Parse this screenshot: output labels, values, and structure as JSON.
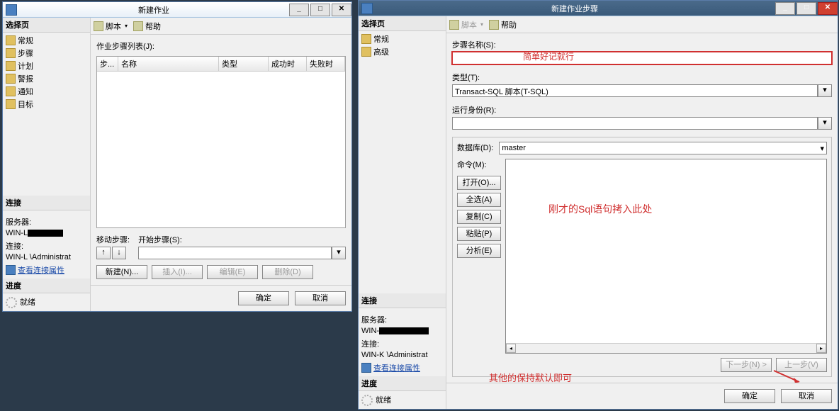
{
  "win1": {
    "title": "新建作业",
    "select_page": "选择页",
    "pages": [
      "常规",
      "步骤",
      "计划",
      "警报",
      "通知",
      "目标"
    ],
    "toolbar": {
      "script": "脚本",
      "help": "帮助"
    },
    "step_list_label": "作业步骤列表(J):",
    "cols": {
      "step": "步...",
      "name": "名称",
      "type": "类型",
      "on_success": "成功时",
      "on_fail": "失败时"
    },
    "move_label": "移动步骤:",
    "start_label": "开始步骤(S):",
    "buttons": {
      "new": "新建(N)...",
      "insert": "插入(I)...",
      "edit": "编辑(E)",
      "delete": "删除(D)"
    },
    "conn_header": "连接",
    "server_label": "服务器:",
    "server_val": "WIN-L",
    "conn_label": "连接:",
    "conn_val": "WIN-L          \\Administrat",
    "view_conn": "查看连接属性",
    "progress_header": "进度",
    "progress_status": "就绪",
    "footer": {
      "ok": "确定",
      "cancel": "取消"
    }
  },
  "win2": {
    "title": "新建作业步骤",
    "select_page": "选择页",
    "pages": [
      "常规",
      "高级"
    ],
    "toolbar": {
      "script": "脚本",
      "help": "帮助"
    },
    "step_name_label": "步骤名称(S):",
    "step_name_val": "",
    "anno_name": "简单好记就行",
    "type_label": "类型(T):",
    "type_val": "Transact-SQL 脚本(T-SQL)",
    "runas_label": "运行身份(R):",
    "runas_val": "",
    "db_label": "数据库(D):",
    "db_val": "master",
    "cmd_label": "命令(M):",
    "cmd_buttons": {
      "open": "打开(O)...",
      "selectall": "全选(A)",
      "copy": "复制(C)",
      "paste": "粘贴(P)",
      "parse": "分析(E)"
    },
    "anno_cmd": "刚才的Sql语句拷入此处",
    "nav": {
      "next": "下一步(N) >",
      "prev": "上一步(V)"
    },
    "anno_bottom": "其他的保持默认即可",
    "conn_header": "连接",
    "server_label": "服务器:",
    "server_val": "WIN-",
    "conn_label": "连接:",
    "conn_val": "WIN-K         \\Administrat",
    "view_conn": "查看连接属性",
    "progress_header": "进度",
    "progress_status": "就绪",
    "footer": {
      "ok": "确定",
      "cancel": "取消"
    }
  }
}
